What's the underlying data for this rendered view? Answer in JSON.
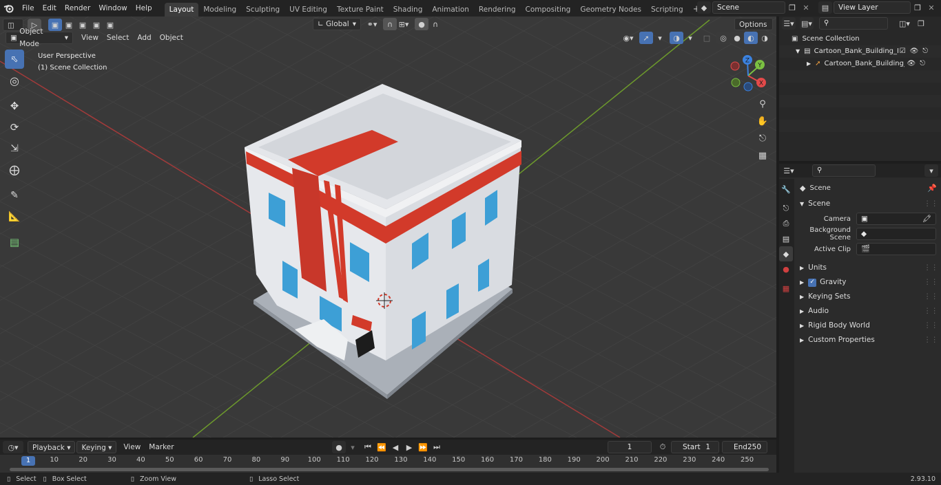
{
  "topbar": {
    "menus": [
      "File",
      "Edit",
      "Render",
      "Window",
      "Help"
    ],
    "workspaces": [
      "Layout",
      "Modeling",
      "Sculpting",
      "UV Editing",
      "Texture Paint",
      "Shading",
      "Animation",
      "Rendering",
      "Compositing",
      "Geometry Nodes",
      "Scripting"
    ],
    "active_workspace": "Layout",
    "scene_name": "Scene",
    "view_layer": "View Layer"
  },
  "viewport": {
    "mode": "Object Mode",
    "menus": [
      "View",
      "Select",
      "Add",
      "Object"
    ],
    "orientation": "Global",
    "options_label": "Options",
    "perspective_label": "User Perspective",
    "collection_label": "(1) Scene Collection",
    "gizmo": {
      "x": "X",
      "y": "Y",
      "z": "Z"
    }
  },
  "outliner": {
    "root": "Scene Collection",
    "collection": "Cartoon_Bank_Building_Red",
    "object": "Cartoon_Bank_Building_I"
  },
  "properties": {
    "context": "Scene",
    "panel": "Scene",
    "fields": [
      {
        "label": "Camera"
      },
      {
        "label": "Background Scene"
      },
      {
        "label": "Active Clip"
      }
    ],
    "sections": [
      "Units",
      "Gravity",
      "Keying Sets",
      "Audio",
      "Rigid Body World",
      "Custom Properties"
    ],
    "gravity_checked": true
  },
  "timeline": {
    "menus": [
      "Playback",
      "Keying",
      "View",
      "Marker"
    ],
    "current_frame": "1",
    "start_label": "Start",
    "start": "1",
    "end_label": "End",
    "end": "250",
    "ruler": [
      "1",
      "10",
      "20",
      "30",
      "40",
      "50",
      "60",
      "70",
      "80",
      "90",
      "100",
      "110",
      "120",
      "130",
      "140",
      "150",
      "160",
      "170",
      "180",
      "190",
      "200",
      "210",
      "220",
      "230",
      "240",
      "250"
    ]
  },
  "status": {
    "items": [
      "Select",
      "Box Select",
      "Zoom View",
      "Lasso Select"
    ],
    "version": "2.93.10"
  },
  "colors": {
    "accent": "#4772b3",
    "building_red": "#d23a2a",
    "window_blue": "#3d9fd6",
    "x_axis": "#e34a4a",
    "y_axis": "#7bc042",
    "z_axis": "#3b82e0"
  }
}
